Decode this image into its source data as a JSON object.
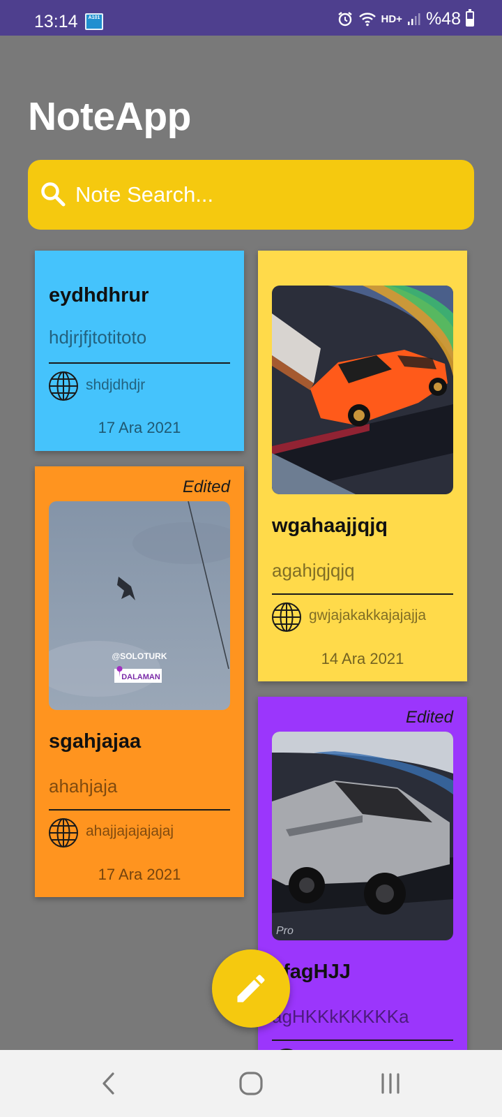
{
  "status_bar": {
    "time": "13:14",
    "app_icon_text": "A101",
    "network_label": "HD+",
    "battery": "%48",
    "icons": [
      "app-notification-icon",
      "alarm-icon",
      "wifi-icon",
      "signal-icon",
      "battery-icon"
    ]
  },
  "app": {
    "title": "NoteApp"
  },
  "search": {
    "placeholder": "Note Search...",
    "value": ""
  },
  "notes": [
    {
      "title": "eydhdhrur",
      "subtitle": "hdjrjfjtotitoto",
      "link": "shdjdhdjr",
      "date": "17 Ara 2021",
      "color": "#45c3fc",
      "edited": "",
      "image": ""
    },
    {
      "title": "wgahaajjqjq",
      "subtitle": "agahjqjqjq",
      "link": "gwjajakakkajajajja",
      "date": "14 Ara 2021",
      "color": "#ffda4a",
      "edited": "",
      "image": "orange toy sports car"
    },
    {
      "title": "sgahjajaa",
      "subtitle": "ahahjaja",
      "link": "ahajjajajajajaj",
      "date": "17 Ara 2021",
      "color": "#ff941f",
      "edited": "Edited",
      "image": "jet aircraft in cloudy sky",
      "image_overlay": {
        "handle": "@SOLOTURK",
        "location": "DALAMAN"
      }
    },
    {
      "title": "afagHJJ",
      "subtitle": "agHKKkKKKKKa",
      "link": "",
      "date": "",
      "color": "#9b36fc",
      "edited": "Edited",
      "image": "silver toy pickup truck",
      "image_overlay": {
        "watermark": "Pro"
      }
    }
  ],
  "nav": {
    "icons": [
      "back-icon",
      "home-icon",
      "recent-apps-icon"
    ]
  },
  "colors": {
    "status_bar": "#4e3f8e",
    "background": "#797979",
    "accent": "#f5c90f",
    "nav_bar": "#f2f2f2"
  }
}
